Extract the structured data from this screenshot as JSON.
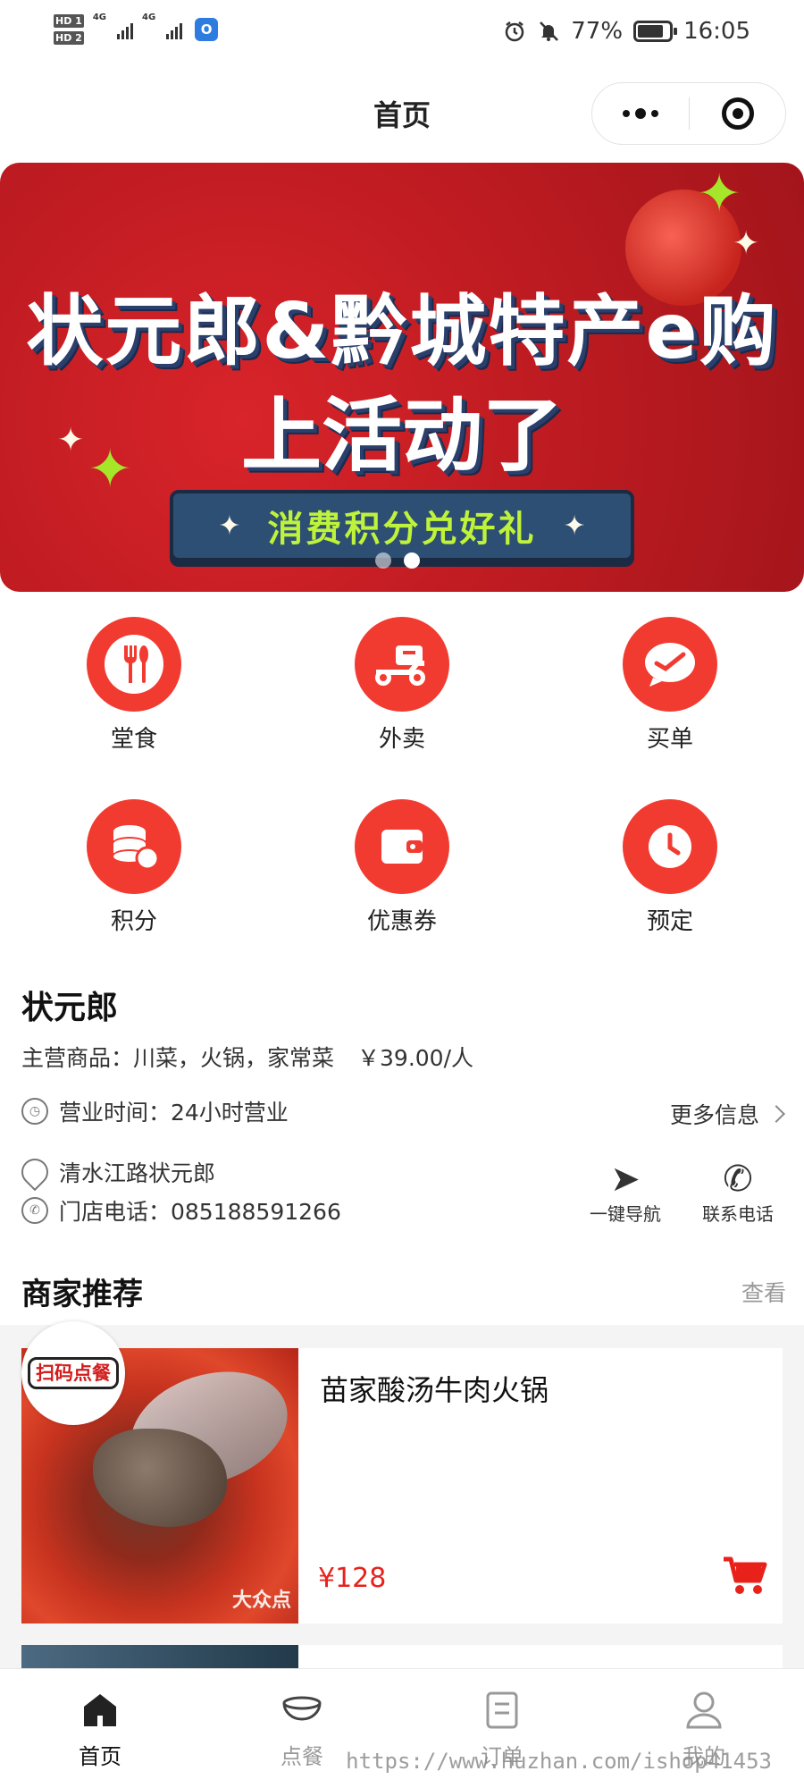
{
  "status_bar": {
    "hd1": "HD 1",
    "hd2": "HD 2",
    "net1": "4G",
    "net2": "4G",
    "battery": "77%",
    "time": "16:05"
  },
  "nav": {
    "title": "首页"
  },
  "banner": {
    "line1": "状元郎&黔城特产e购",
    "line2": "上活动了",
    "pill": "消费积分兑好礼",
    "slides": 2,
    "active_slide": 2
  },
  "grid": {
    "items": [
      {
        "label": "堂食",
        "icon": "fork-spoon-icon"
      },
      {
        "label": "外卖",
        "icon": "delivery-scooter-icon"
      },
      {
        "label": "买单",
        "icon": "checkmark-chat-icon"
      },
      {
        "label": "积分",
        "icon": "coins-stack-icon"
      },
      {
        "label": "优惠券",
        "icon": "wallet-icon"
      },
      {
        "label": "预定",
        "icon": "clock-icon"
      }
    ]
  },
  "store": {
    "name": "状元郎",
    "main_label": "主营商品：川菜，火锅，家常菜",
    "price": "￥39.00/人",
    "hours": "营业时间：24小时营业",
    "more_info": "更多信息",
    "address": "清水江路状元郎",
    "phone": "门店电话：085188591266",
    "navigate": "一键导航",
    "call": "联系电话"
  },
  "recommend": {
    "title": "商家推荐",
    "more": "查看",
    "badge": "扫码点餐",
    "items": [
      {
        "name": "苗家酸汤牛肉火锅",
        "price": "¥128",
        "watermark": "大众点"
      }
    ]
  },
  "tabbar": {
    "items": [
      {
        "label": "首页",
        "icon": "home-icon",
        "active": true
      },
      {
        "label": "点餐",
        "icon": "bowl-icon",
        "active": false
      },
      {
        "label": "订单",
        "icon": "order-icon",
        "active": false
      },
      {
        "label": "我的",
        "icon": "user-icon",
        "active": false
      }
    ]
  },
  "watermark": "https://www.huzhan.com/ishop41453",
  "colors": {
    "accent": "#f23b30",
    "price": "#e8221b",
    "banner_red": "#c01c22",
    "pill_text": "#bff23a"
  }
}
